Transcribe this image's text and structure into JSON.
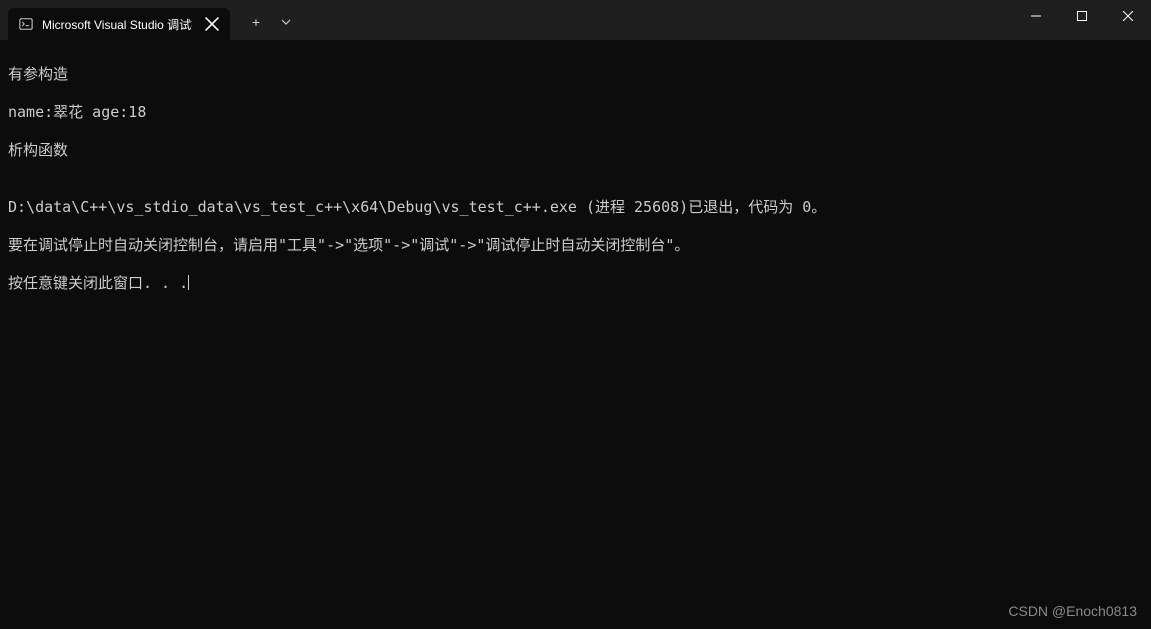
{
  "titlebar": {
    "tab_title": "Microsoft Visual Studio 调试控",
    "new_tab_symbol": "+",
    "close_symbol": "✕"
  },
  "terminal": {
    "lines": [
      "有参构造",
      "name:翠花 age:18",
      "析构函数",
      "",
      "D:\\data\\C++\\vs_stdio_data\\vs_test_c++\\x64\\Debug\\vs_test_c++.exe (进程 25608)已退出，代码为 0。",
      "要在调试停止时自动关闭控制台，请启用\"工具\"->\"选项\"->\"调试\"->\"调试停止时自动关闭控制台\"。",
      "按任意键关闭此窗口. . ."
    ]
  },
  "watermark": "CSDN @Enoch0813"
}
